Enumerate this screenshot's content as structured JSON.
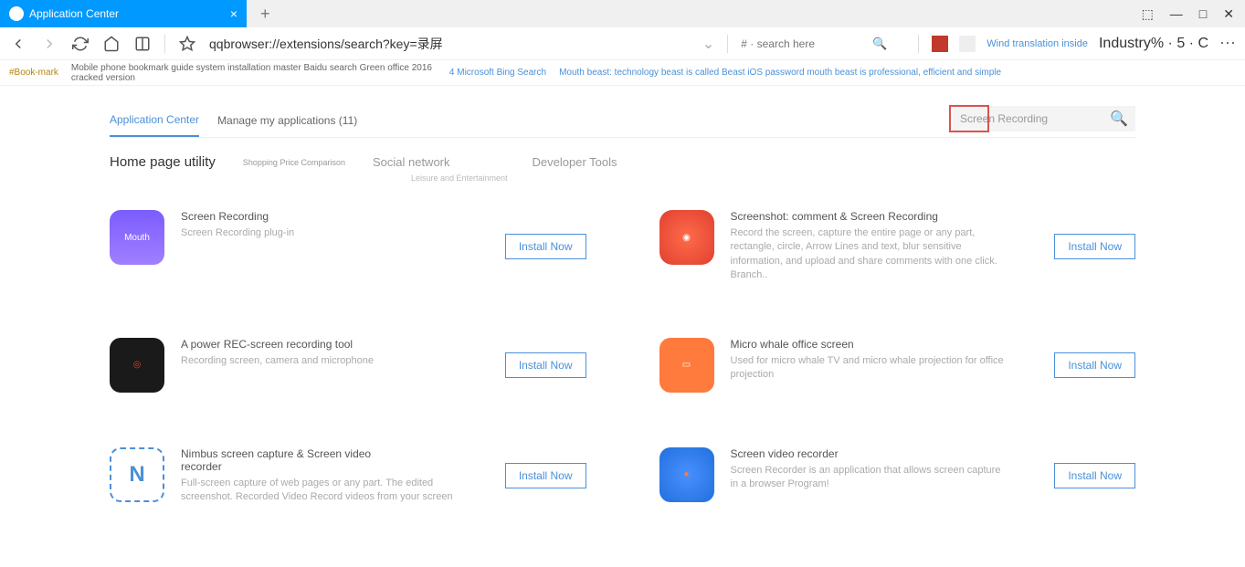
{
  "tab": {
    "title": "Application Center"
  },
  "nav": {
    "url": "qqbrowser://extensions/search?key=录屏",
    "search_placeholder": "# · search here",
    "translation": "Wind translation inside",
    "industry": "Industry% · 5 · C"
  },
  "bookmarks": {
    "first": "#Book-mark",
    "second": "Mobile phone bookmark guide system installation master Baidu search Green office 2016 cracked version",
    "link": "4 Microsoft Bing Search",
    "link2": "Mouth beast: technology beast is called Beast iOS password mouth beast is professional, efficient and simple"
  },
  "app_tabs": {
    "center": "Application Center",
    "manage": "Manage my applications (11)"
  },
  "search_ext": {
    "value": "Screen Recording"
  },
  "categories": {
    "home": "Home page utility",
    "shopping": "Shopping Price Comparison",
    "social": "Social network",
    "dev": "Developer Tools",
    "leisure": "Leisure and Entertainment"
  },
  "apps": [
    {
      "title": "Screen Recording",
      "desc": "Screen Recording plug-in",
      "install": "Install Now",
      "icon_text": "Mouth"
    },
    {
      "title": "Screenshot: comment & Screen Recording",
      "desc": "Record the screen, capture the entire page or any part, rectangle, circle, Arrow Lines and text, blur sensitive information, and upload and share comments with one click. Branch..",
      "install": "Install Now"
    },
    {
      "title": "A power REC-screen recording tool",
      "desc": "Recording screen, camera and microphone",
      "install": "Install Now"
    },
    {
      "title": "Micro whale office screen",
      "desc": "Used for micro whale TV and micro whale projection for office projection",
      "install": "Install Now"
    },
    {
      "title": "Nimbus screen capture & Screen video recorder",
      "desc": "Full-screen capture of web pages or any part. The edited screenshot. Recorded Video Record videos from your screen",
      "install": "Install Now",
      "icon_text": "N"
    },
    {
      "title": "Screen video recorder",
      "desc": "Screen Recorder is an application that allows screen capture in a browser Program!",
      "install": "Install Now"
    }
  ]
}
